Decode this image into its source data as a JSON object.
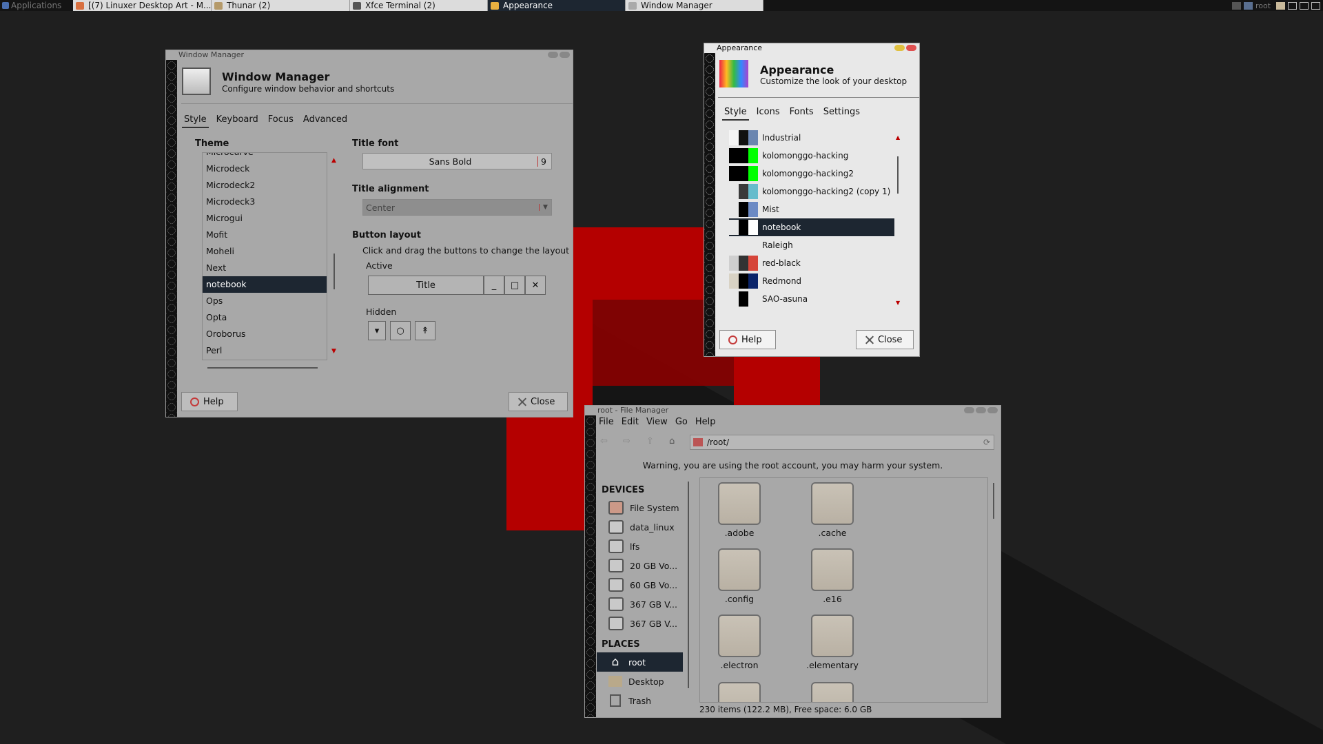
{
  "panel": {
    "apps_label": "Applications",
    "tasks": [
      {
        "label": "[(7) Linuxer Desktop Art - M...",
        "icon": "browser-icon",
        "color": "#d87040",
        "active": false
      },
      {
        "label": "Thunar (2)",
        "icon": "file-manager-icon",
        "color": "#b59a6a",
        "active": false
      },
      {
        "label": "Xfce Terminal (2)",
        "icon": "terminal-icon",
        "color": "#555555",
        "active": false
      },
      {
        "label": "Appearance",
        "icon": "appearance-icon",
        "color": "#e8b040",
        "active": true
      },
      {
        "label": "Window Manager",
        "icon": "window-icon",
        "color": "#aaaaaa",
        "active": false
      }
    ],
    "user": "root"
  },
  "colors": {
    "selection": "#1d2631",
    "accent_red": "#b40000"
  },
  "window_manager": {
    "title": "Window Manager",
    "heading": "Window Manager",
    "subheading": "Configure window behavior and shortcuts",
    "tabs": [
      "Style",
      "Keyboard",
      "Focus",
      "Advanced"
    ],
    "theme_label": "Theme",
    "themes": [
      "Microcurve",
      "Microdeck",
      "Microdeck2",
      "Microdeck3",
      "Microgui",
      "Mofit",
      "Moheli",
      "Next",
      "notebook",
      "Ops",
      "Opta",
      "Oroborus",
      "Perl"
    ],
    "selected_theme": "notebook",
    "title_font_label": "Title font",
    "title_font_value": "Sans Bold",
    "title_font_size": "9",
    "title_alignment_label": "Title alignment",
    "title_alignment_value": "Center",
    "button_layout_label": "Button layout",
    "button_layout_hint": "Click and drag the buttons to change the layout",
    "active_label": "Active",
    "active_title": "Title",
    "active_buttons": [
      "_",
      "□",
      "✕"
    ],
    "hidden_label": "Hidden",
    "hidden_buttons": [
      "▾",
      "○",
      "↟"
    ],
    "help": "Help",
    "close": "Close"
  },
  "appearance": {
    "title": "Appearance",
    "heading": "Appearance",
    "subheading": "Customize the look of your desktop",
    "tabs": [
      "Style",
      "Icons",
      "Fonts",
      "Settings"
    ],
    "themes": [
      {
        "name": "Industrial",
        "colors": [
          "#f5f5f5",
          "#111111",
          "#6b86b0"
        ]
      },
      {
        "name": "kolomonggo-hacking",
        "colors": [
          "#000000",
          "#000000",
          "#00ff00"
        ]
      },
      {
        "name": "kolomonggo-hacking2",
        "colors": [
          "#000000",
          "#000000",
          "#00ff00"
        ]
      },
      {
        "name": "kolomonggo-hacking2 (copy 1)",
        "colors": [
          "#e8e8e8",
          "#3a3a3a",
          "#66bccc"
        ]
      },
      {
        "name": "Mist",
        "colors": [
          "#e8e8e8",
          "#000000",
          "#6c8ac4"
        ]
      },
      {
        "name": "notebook",
        "colors": [
          "#e8e8e8",
          "#000000",
          "#ffffff"
        ]
      },
      {
        "name": "Raleigh",
        "colors": [
          "#e8e8e8",
          "#e8e8e8",
          "#e8e8e8"
        ]
      },
      {
        "name": "red-black",
        "colors": [
          "#cfcfcf",
          "#333333",
          "#d6453a"
        ]
      },
      {
        "name": "Redmond",
        "colors": [
          "#d8d2c4",
          "#000000",
          "#0a246a"
        ]
      },
      {
        "name": "SAO-asuna",
        "colors": [
          "#e8e8e8",
          "#000000",
          "#e8e8e8"
        ]
      }
    ],
    "selected_theme": "notebook",
    "help": "Help",
    "close": "Close"
  },
  "file_manager": {
    "title": "root - File Manager",
    "menu": [
      "File",
      "Edit",
      "View",
      "Go",
      "Help"
    ],
    "location": "/root/",
    "warning": "Warning, you are using the root account, you may harm your system.",
    "devices_header": "DEVICES",
    "devices": [
      "File System",
      "data_linux",
      "lfs",
      "20 GB Vo...",
      "60 GB Vo...",
      "367 GB V...",
      "367 GB V..."
    ],
    "places_header": "PLACES",
    "places": [
      {
        "label": "root",
        "icon": "home-icon"
      },
      {
        "label": "Desktop",
        "icon": "desktop-folder-icon"
      },
      {
        "label": "Trash",
        "icon": "trash-icon"
      }
    ],
    "folders": [
      ".adobe",
      ".cache",
      ".config",
      ".e16",
      ".electron",
      ".elementary"
    ],
    "status": "230 items (122.2 MB), Free space: 6.0 GB"
  }
}
